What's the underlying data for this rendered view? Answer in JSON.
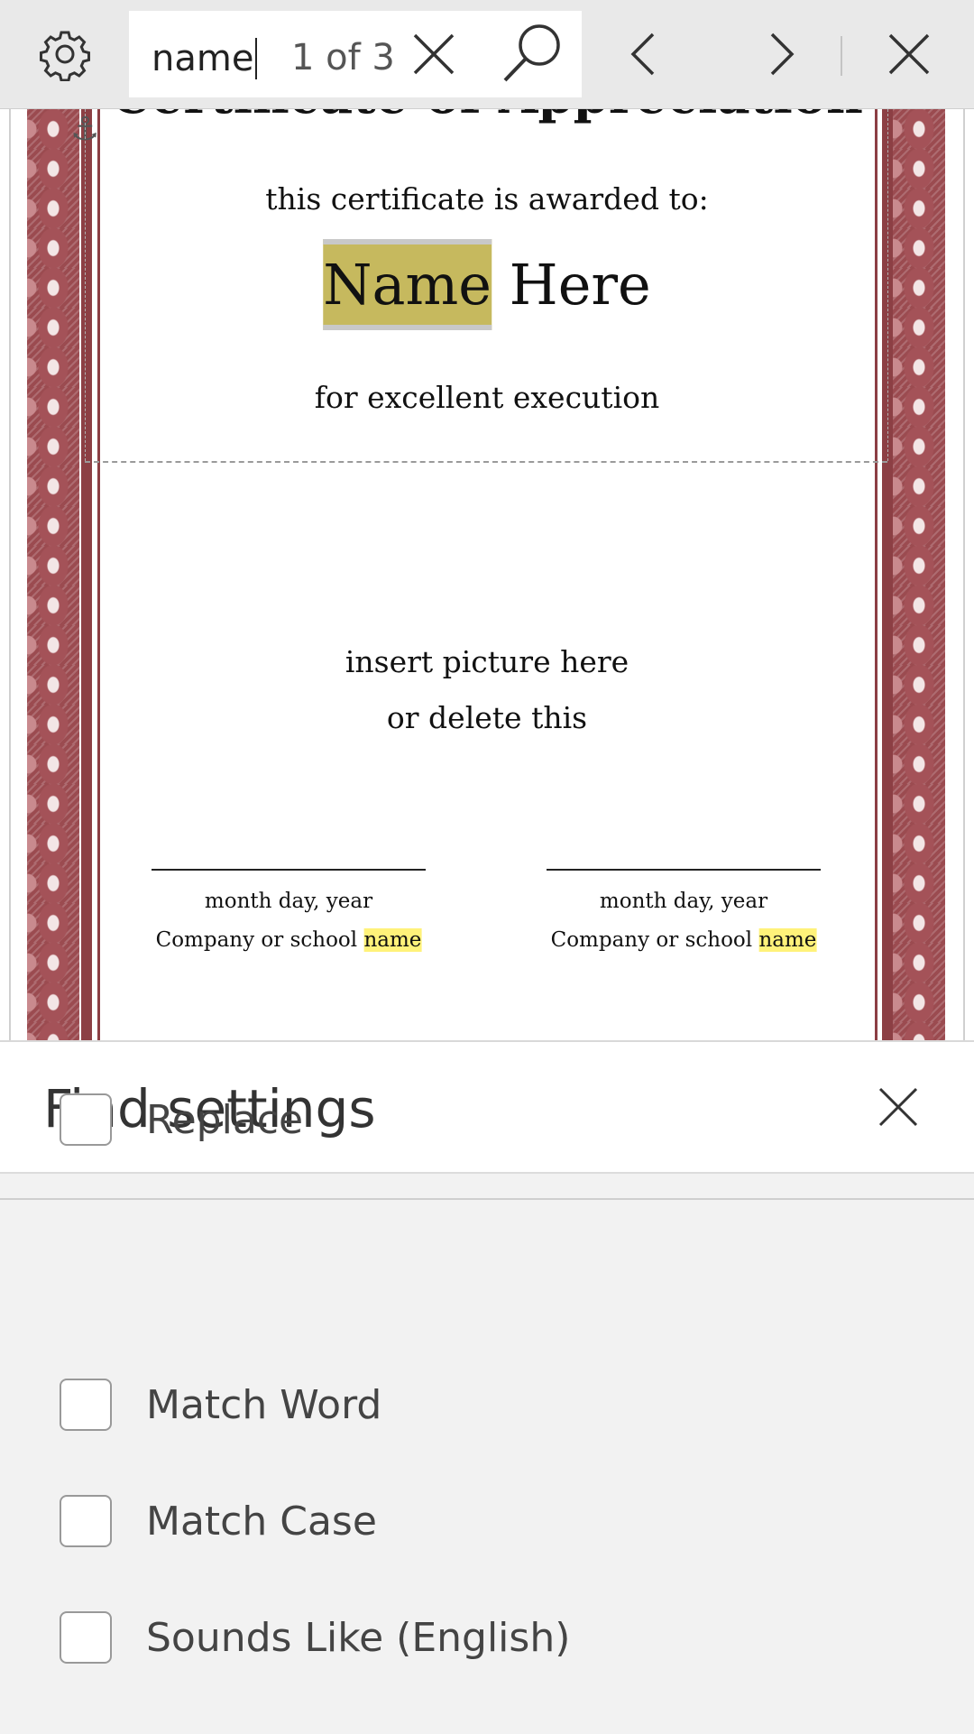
{
  "find_bar": {
    "settings_icon": "gear-icon",
    "search_value": "name",
    "match_counter": "1 of 3",
    "clear_icon": "close-icon",
    "search_icon": "search-icon",
    "prev_icon": "chevron-left-icon",
    "next_icon": "chevron-right-icon",
    "close_icon": "close-icon"
  },
  "document": {
    "title": "Certificate of Appreciation",
    "awarded_line": "this certificate is awarded to:",
    "name_match": "Name",
    "name_rest": " Here",
    "excellence_line": "for excellent execution",
    "picture_line1": "insert picture here",
    "picture_line2": "or delete this",
    "signatures": [
      {
        "date": "month day, year",
        "company_prefix": "Company or school ",
        "company_match": "name"
      },
      {
        "date": "month day, year",
        "company_prefix": "Company or school ",
        "company_match": "name"
      }
    ],
    "highlight_current_color": "#c6b95e",
    "highlight_color": "#fff27a",
    "border_color": "#9b4b50"
  },
  "find_settings": {
    "title": "Find settings",
    "close_icon": "close-icon",
    "options": [
      {
        "label": "Replace",
        "checked": false
      },
      {
        "label": "Match Word",
        "checked": false
      },
      {
        "label": "Match Case",
        "checked": false
      },
      {
        "label": "Sounds Like (English)",
        "checked": false
      }
    ]
  }
}
